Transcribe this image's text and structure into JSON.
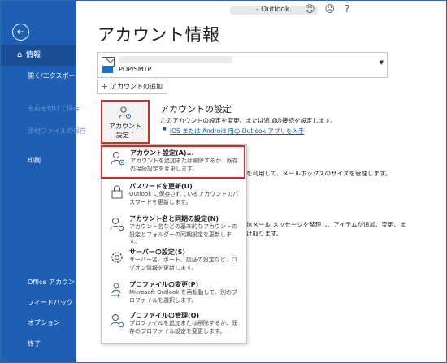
{
  "window": {
    "app_name": "Outlook",
    "title_icons": [
      "☺",
      "☹",
      "?"
    ]
  },
  "sidebar": {
    "back_icon": "back-arrow-icon",
    "items": [
      {
        "label": "情報",
        "selected": true,
        "enabled": true
      },
      {
        "label": "開く/エクスポート",
        "enabled": true
      },
      {
        "label": "名前を付けて保存",
        "enabled": false
      },
      {
        "label": "添付ファイルの保存",
        "enabled": false
      },
      {
        "label": "印刷",
        "enabled": true
      },
      {
        "label": "Office アカウント",
        "enabled": true
      },
      {
        "label": "フィードバック",
        "enabled": true
      },
      {
        "label": "オプション",
        "enabled": true
      },
      {
        "label": "終了",
        "enabled": true
      }
    ]
  },
  "page": {
    "title": "アカウント情報"
  },
  "account_selector": {
    "type": "POP/SMTP"
  },
  "add_account_label": "アカウントの追加",
  "account_settings": {
    "button_label": "アカウント\n設定 ˇ",
    "title": "アカウントの設定",
    "description": "このアカウントの設定を変更、または追加の接続を設定します。",
    "link": "iOS または Android 用の Outlook アプリを入手"
  },
  "background": {
    "mailbox_text": "を利用して、メールボックスのサイズを管理します。",
    "rules_text_1": "信メール メッセージを整理し、アイテムが追加、変更、ま",
    "rules_text_2": "け取ります。"
  },
  "menu": [
    {
      "title": "アカウント設定(A)...",
      "desc": "アカウントを追加または削除するか、既存の接続設定を変更します。",
      "icon": "account-settings-icon",
      "highlighted": true
    },
    {
      "title": "パスワードを更新(U)",
      "desc": "Outlook に保存されているアカウントのパスワードを更新します。",
      "icon": "lock-icon"
    },
    {
      "title": "アカウント名と同期の設定(N)",
      "desc": "アカウント名などの基本的なアカウントの設定とフォルダーの同期設定を更新します。",
      "icon": "account-sync-icon"
    },
    {
      "title": "サーバーの設定(S)",
      "desc": "サーバー名、ポート、認証の設定など、ログオン情報を更新します。",
      "icon": "server-gear-icon"
    },
    {
      "title": "プロファイルの変更(P)",
      "desc": "Microsoft Outlook を再起動して、別のプロファイルを選択します。",
      "icon": "profile-change-icon"
    },
    {
      "title": "プロファイルの管理(O)",
      "desc": "プロファイルを追加または削除するか、既存のプロファイル設定を変更します。",
      "icon": "profile-manage-icon"
    }
  ]
}
